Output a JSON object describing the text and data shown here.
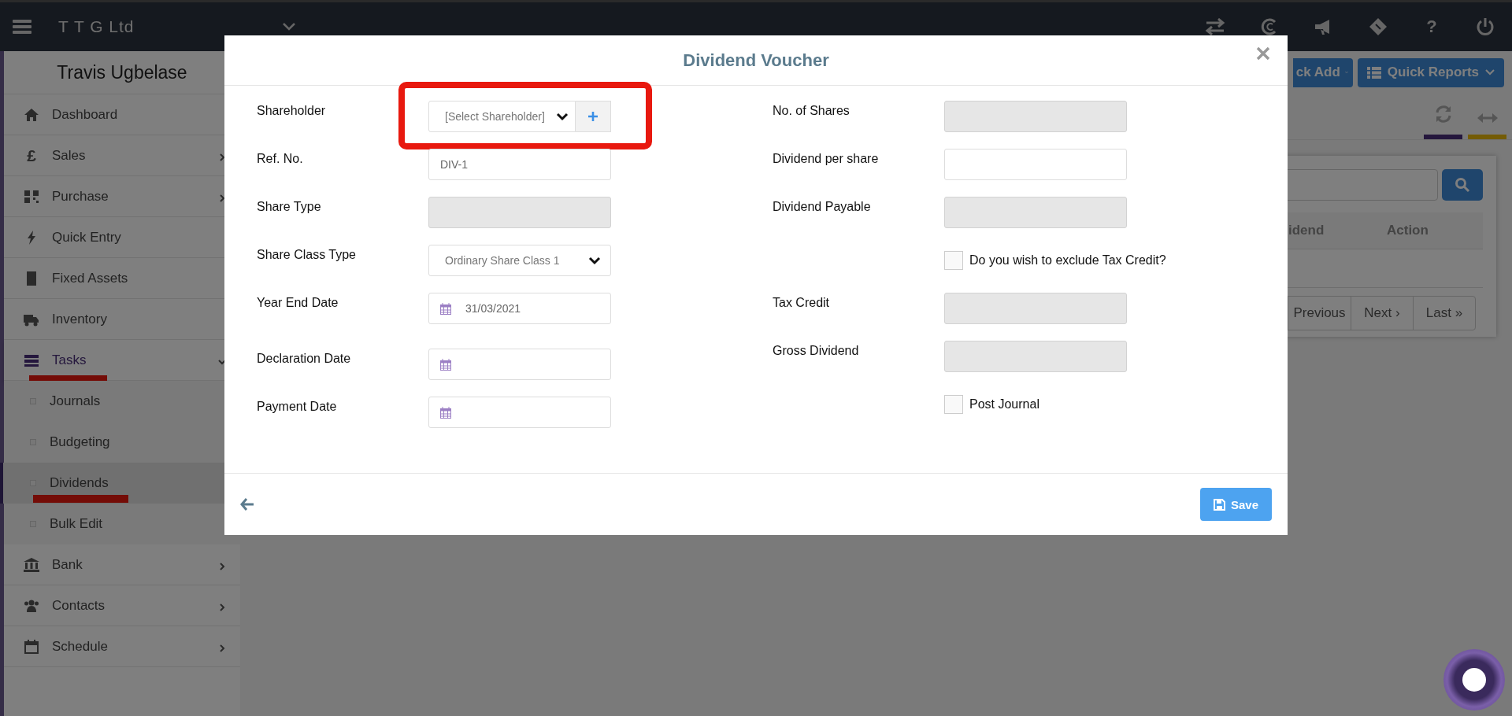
{
  "top_bar": {
    "company": "T T G Ltd",
    "help_glyph": "?"
  },
  "sidebar": {
    "user": "Travis Ugbelase",
    "items": [
      {
        "label": "Dashboard",
        "has_submenu": false,
        "expanded": false,
        "annotated": false
      },
      {
        "label": "Sales",
        "icon_glyph": "£",
        "has_submenu": true,
        "expanded": false,
        "annotated": false
      },
      {
        "label": "Purchase",
        "has_submenu": true,
        "expanded": false,
        "annotated": false
      },
      {
        "label": "Quick Entry",
        "has_submenu": false,
        "expanded": false,
        "annotated": false
      },
      {
        "label": "Fixed Assets",
        "has_submenu": false,
        "expanded": false,
        "annotated": false
      },
      {
        "label": "Inventory",
        "has_submenu": false,
        "expanded": false,
        "annotated": false
      },
      {
        "label": "Tasks",
        "has_submenu": true,
        "expanded": true,
        "annotated": true,
        "children": [
          {
            "label": "Journals",
            "selected": false,
            "annotated": false
          },
          {
            "label": "Budgeting",
            "selected": false,
            "annotated": false
          },
          {
            "label": "Dividends",
            "selected": true,
            "annotated": true
          },
          {
            "label": "Bulk Edit",
            "selected": false,
            "annotated": false
          }
        ]
      },
      {
        "label": "Bank",
        "has_submenu": true,
        "expanded": false,
        "annotated": false
      },
      {
        "label": "Contacts",
        "has_submenu": true,
        "expanded": false,
        "annotated": false
      },
      {
        "label": "Schedule",
        "has_submenu": true,
        "expanded": false,
        "annotated": false
      }
    ]
  },
  "header_buttons": [
    "ck Add",
    "Quick Reports"
  ],
  "list_panel": {
    "columns": [
      "idend",
      "Action"
    ],
    "pagination": [
      "Previous",
      "Next ›",
      "Last »"
    ]
  },
  "modal": {
    "title": "Dividend Voucher",
    "left_fields": [
      {
        "label": "Shareholder",
        "kind": "select",
        "placeholder": "[Select Shareholder]",
        "add_button": true,
        "annotated": true
      },
      {
        "label": "Ref. No.",
        "kind": "text",
        "value": "DIV-1",
        "readonly": false
      },
      {
        "label": "Share Type",
        "kind": "text",
        "readonly": true
      },
      {
        "label": "Share Class Type",
        "kind": "select",
        "value": "Ordinary Share Class 1"
      },
      {
        "label": "Year End Date",
        "kind": "date",
        "value": "31/03/2021"
      },
      {
        "label": "Declaration Date",
        "kind": "date"
      },
      {
        "label": "Payment Date",
        "kind": "date"
      }
    ],
    "right_fields": [
      {
        "label": "No. of Shares",
        "kind": "text",
        "readonly": true
      },
      {
        "label": "Dividend per share",
        "kind": "text",
        "readonly": false
      },
      {
        "label": "Dividend Payable",
        "kind": "text",
        "readonly": true
      },
      {
        "label": "Do you wish to exclude Tax Credit?",
        "kind": "checkbox",
        "checked": false
      },
      {
        "label": "Tax Credit",
        "kind": "text",
        "readonly": true
      },
      {
        "label": "Gross Dividend",
        "kind": "text",
        "readonly": true
      },
      {
        "label": "Post Journal",
        "kind": "checkbox",
        "checked": false
      }
    ],
    "save": "Save"
  }
}
